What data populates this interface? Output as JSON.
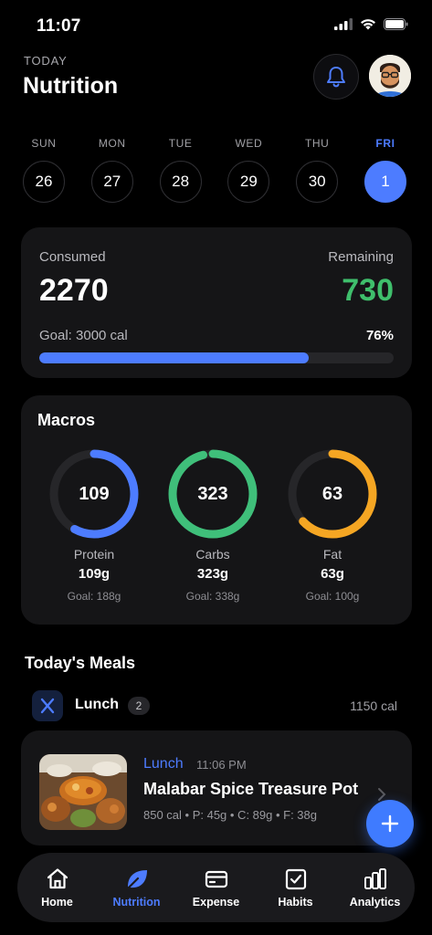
{
  "status_bar": {
    "time": "11:07"
  },
  "header": {
    "eyebrow": "TODAY",
    "title": "Nutrition"
  },
  "week": [
    {
      "name": "SUN",
      "num": "26",
      "active": false
    },
    {
      "name": "MON",
      "num": "27",
      "active": false
    },
    {
      "name": "TUE",
      "num": "28",
      "active": false
    },
    {
      "name": "WED",
      "num": "29",
      "active": false
    },
    {
      "name": "THU",
      "num": "30",
      "active": false
    },
    {
      "name": "FRI",
      "num": "1",
      "active": true
    }
  ],
  "summary": {
    "consumed_label": "Consumed",
    "consumed_value": "2270",
    "remaining_label": "Remaining",
    "remaining_value": "730",
    "goal_text": "Goal: 3000 cal",
    "percent_text": "76%",
    "progress_fraction": 0.76
  },
  "macros": {
    "title": "Macros",
    "items": [
      {
        "value": "109",
        "name": "Protein",
        "grams": "109g",
        "goal": "Goal: 188g",
        "fraction": 0.58,
        "color": "#4d7cff"
      },
      {
        "value": "323",
        "name": "Carbs",
        "grams": "323g",
        "goal": "Goal: 338g",
        "fraction": 0.96,
        "color": "#3fbf7a"
      },
      {
        "value": "63",
        "name": "Fat",
        "grams": "63g",
        "goal": "Goal: 100g",
        "fraction": 0.63,
        "color": "#f5a623"
      }
    ]
  },
  "meals": {
    "title": "Today's Meals",
    "group": {
      "name": "Lunch",
      "count": "2",
      "calories": "1150 cal"
    },
    "entry": {
      "type": "Lunch",
      "time": "11:06 PM",
      "name": "Malabar Spice Treasure Pot",
      "details": "850 cal • P: 45g • C: 89g • F: 38g"
    }
  },
  "nav": {
    "items": [
      {
        "label": "Home",
        "icon": "home-icon",
        "active": false
      },
      {
        "label": "Nutrition",
        "icon": "leaf-icon",
        "active": true
      },
      {
        "label": "Expense",
        "icon": "card-icon",
        "active": false
      },
      {
        "label": "Habits",
        "icon": "checkbox-icon",
        "active": false
      },
      {
        "label": "Analytics",
        "icon": "bar-chart-icon",
        "active": false
      }
    ]
  },
  "colors": {
    "accent": "#4d7cff",
    "remaining": "#3fbf6c",
    "card": "#151517"
  }
}
